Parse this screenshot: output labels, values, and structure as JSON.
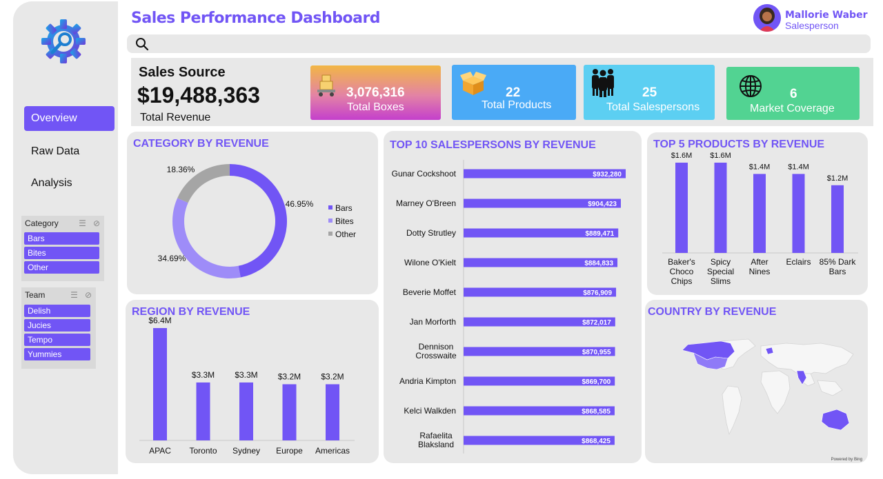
{
  "app": {
    "title": "Sales Performance Dashboard"
  },
  "user": {
    "name": "Mallorie Waber",
    "role": "Salesperson"
  },
  "nav": {
    "items": [
      "Overview",
      "Raw Data",
      "Analysis"
    ],
    "active": "Overview"
  },
  "slicers": {
    "category": {
      "label": "Category",
      "items": [
        "Bars",
        "Bites",
        "Other"
      ]
    },
    "team": {
      "label": "Team",
      "items": [
        "Delish",
        "Jucies",
        "Tempo",
        "Yummies"
      ]
    }
  },
  "search": {
    "icon": "search-icon"
  },
  "sales_source": {
    "title": "Sales Source",
    "value": "$19,488,363",
    "label": "Total Revenue"
  },
  "kpis": [
    {
      "value": "3,076,316",
      "label": "Total Boxes",
      "icon": "box-cart-icon"
    },
    {
      "value": "22",
      "label": "Total Products",
      "icon": "open-box-icon"
    },
    {
      "value": "25",
      "label": "Total Salespersons",
      "icon": "people-icon"
    },
    {
      "value": "6",
      "label": "Market Coverage",
      "icon": "globe-icon"
    }
  ],
  "colors": {
    "accent": "#7155f5",
    "bites": "#9e8cf8",
    "other": "#a5a5a5",
    "panel": "#e8e8e8"
  },
  "map": {
    "title": "COUNTRY BY REVENUE",
    "attribution": "Powered by Bing"
  },
  "chart_data": [
    {
      "type": "pie",
      "title": "CATEGORY BY REVENUE",
      "categories": [
        "Bars",
        "Bites",
        "Other"
      ],
      "values": [
        46.95,
        34.69,
        18.36
      ],
      "labels": [
        "46.95%",
        "34.69%",
        "18.36%"
      ],
      "legend": "right"
    },
    {
      "type": "bar",
      "title": "TOP 10 SALESPERSONS BY REVENUE",
      "orientation": "horizontal",
      "categories": [
        "Gunar Cockshoot",
        "Marney O'Breen",
        "Dotty Strutley",
        "Wilone O'Kielt",
        "Beverie Moffet",
        "Jan Morforth",
        "Dennison Crosswaite",
        "Andria Kimpton",
        "Kelci Walkden",
        "Rafaelita Blaksland"
      ],
      "values": [
        932280,
        904423,
        889471,
        884833,
        876909,
        872017,
        870955,
        869700,
        868585,
        868425
      ],
      "labels": [
        "$932,280",
        "$904,423",
        "$889,471",
        "$884,833",
        "$876,909",
        "$872,017",
        "$870,955",
        "$869,700",
        "$868,585",
        "$868,425"
      ]
    },
    {
      "type": "bar",
      "title": "TOP 5 PRODUCTS BY REVENUE",
      "categories": [
        "Baker's Choco Chips",
        "Spicy Special Slims",
        "After Nines",
        "Eclairs",
        "85% Dark Bars"
      ],
      "values": [
        1.6,
        1.6,
        1.4,
        1.4,
        1.2
      ],
      "labels": [
        "$1.6M",
        "$1.6M",
        "$1.4M",
        "$1.4M",
        "$1.2M"
      ]
    },
    {
      "type": "bar",
      "title": "REGION BY REVENUE",
      "categories": [
        "APAC",
        "Toronto",
        "Sydney",
        "Europe",
        "Americas"
      ],
      "values": [
        6.4,
        3.3,
        3.3,
        3.2,
        3.2
      ],
      "labels": [
        "$6.4M",
        "$3.3M",
        "$3.3M",
        "$3.2M",
        "$3.2M"
      ]
    }
  ]
}
